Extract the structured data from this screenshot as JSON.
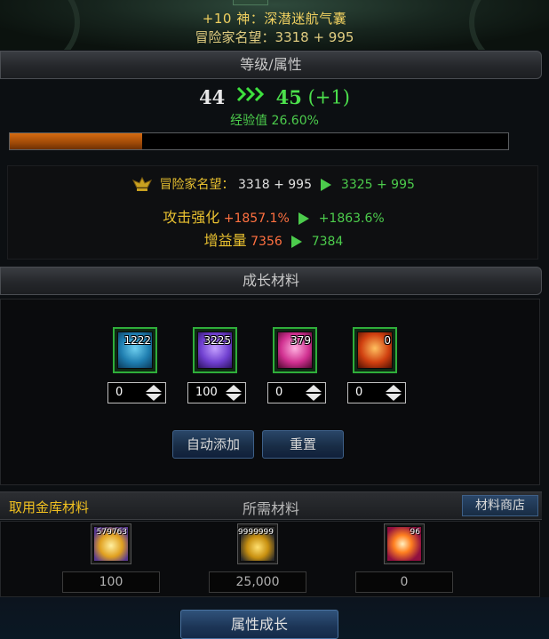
{
  "banner": {
    "item_name": "+10 神：深潜迷航气囊",
    "fame_line": "冒险家名望：3318 + 995"
  },
  "level_section": {
    "title": "等级/属性",
    "current_level": "44",
    "next_level": "45",
    "level_gain": "(+1)",
    "exp_label": "经验值",
    "exp_value": "26.60%",
    "exp_progress": 0.266,
    "arrow_icon": "triple-chevron-right"
  },
  "stats": {
    "fame_label": "冒险家名望：",
    "fame_old": "3318 + 995",
    "fame_new": "3325 + 995",
    "attack_label": "攻击强化",
    "attack_old": "+1857.1%",
    "attack_new": "+1863.6%",
    "buff_label": "增益量",
    "buff_old": "7356",
    "buff_new": "7384"
  },
  "growth": {
    "title": "成长材料",
    "materials": [
      {
        "icon": "blue-crystal-icon",
        "count": "1222",
        "input": "0"
      },
      {
        "icon": "purple-crystal-icon",
        "count": "3225",
        "input": "100"
      },
      {
        "icon": "pink-crystal-icon",
        "count": "379",
        "input": "0"
      },
      {
        "icon": "red-crystal-icon",
        "count": "0",
        "input": "0"
      }
    ],
    "auto_add_label": "自动添加",
    "reset_label": "重置"
  },
  "required": {
    "warehouse_label": "取用金库材料",
    "title": "所需材料",
    "shop_label": "材料商店",
    "items": [
      {
        "icon": "gold-gem-icon",
        "count": "579763",
        "amount": "100"
      },
      {
        "icon": "gold-coin-icon",
        "count": "9999999",
        "amount": "25,000"
      },
      {
        "icon": "orange-orb-icon",
        "count": "96",
        "amount": "0"
      }
    ]
  },
  "footer": {
    "grow_button": "属性成长"
  },
  "colors": {
    "accent_green": "#4ccc4c",
    "accent_gold": "#e8c030",
    "exp_orange": "#d66a10",
    "old_value_orange": "#ff7040",
    "button_blue": "#1c3556"
  }
}
